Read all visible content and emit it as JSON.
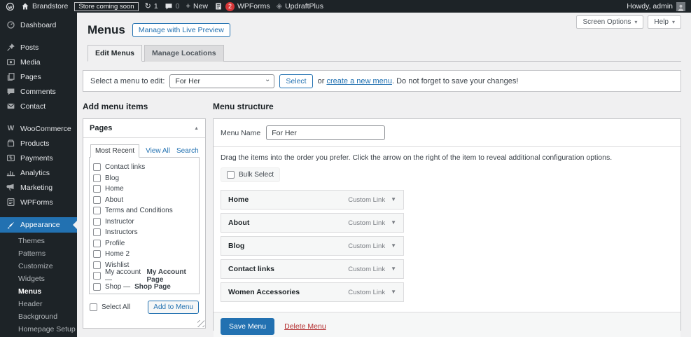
{
  "icons": {
    "woocommerce": "W",
    "payments_dollar": "$",
    "plus": "+",
    "update": "↻",
    "updraft": "◈",
    "collapse_up": "▲",
    "dropdown_down": "▼",
    "small_down": "▾",
    "select_chevron": "⌄"
  },
  "admin_bar": {
    "site_name": "Brandstore",
    "coming_soon_badge": "Store coming soon",
    "update_count": "1",
    "comment_count": "0",
    "new_label": "New",
    "wpforms_badge": "2",
    "wpforms_label": "WPForms",
    "updraft_label": "UpdraftPlus",
    "howdy": "Howdy, admin"
  },
  "sidebar": {
    "items": [
      {
        "label": "Dashboard"
      },
      {
        "label": "Posts"
      },
      {
        "label": "Media"
      },
      {
        "label": "Pages"
      },
      {
        "label": "Comments"
      },
      {
        "label": "Contact"
      },
      {
        "label": "WooCommerce"
      },
      {
        "label": "Products"
      },
      {
        "label": "Payments"
      },
      {
        "label": "Analytics"
      },
      {
        "label": "Marketing"
      },
      {
        "label": "WPForms"
      }
    ],
    "appearance_label": "Appearance",
    "submenu": [
      {
        "label": "Themes"
      },
      {
        "label": "Patterns"
      },
      {
        "label": "Customize"
      },
      {
        "label": "Widgets"
      },
      {
        "label": "Menus"
      },
      {
        "label": "Header"
      },
      {
        "label": "Background"
      },
      {
        "label": "Homepage Setup"
      }
    ]
  },
  "header": {
    "title": "Menus",
    "live_preview_button": "Manage with Live Preview",
    "screen_options": "Screen Options",
    "help": "Help"
  },
  "tabs": {
    "edit_menus": "Edit Menus",
    "manage_locations": "Manage Locations"
  },
  "select_bar": {
    "label": "Select a menu to edit:",
    "selected_menu": "For Her",
    "select_button": "Select",
    "or_text": "or",
    "create_link": "create a new menu",
    "after_text": ". Do not forget to save your changes!"
  },
  "add_menu_items": {
    "heading": "Add menu items",
    "box_title": "Pages",
    "tab_most_recent": "Most Recent",
    "tab_view_all": "View All",
    "tab_search": "Search",
    "pages": [
      {
        "label": "Contact links"
      },
      {
        "label": "Blog"
      },
      {
        "label": "Home"
      },
      {
        "label": "About"
      },
      {
        "label": "Terms and Conditions"
      },
      {
        "label": "Instructor"
      },
      {
        "label": "Instructors"
      },
      {
        "label": "Profile"
      },
      {
        "label": "Home 2"
      },
      {
        "label": "Wishlist"
      },
      {
        "label": "My account — ",
        "bold": "My Account Page"
      },
      {
        "label": "Shop — ",
        "bold": "Shop Page"
      }
    ],
    "select_all": "Select All",
    "add_button": "Add to Menu"
  },
  "menu_structure": {
    "heading": "Menu structure",
    "name_label": "Menu Name",
    "name_value": "For Her",
    "instructions": "Drag the items into the order you prefer. Click the arrow on the right of the item to reveal additional configuration options.",
    "bulk_select": "Bulk Select",
    "items": [
      {
        "title": "Home",
        "type": "Custom Link"
      },
      {
        "title": "About",
        "type": "Custom Link"
      },
      {
        "title": "Blog",
        "type": "Custom Link"
      },
      {
        "title": "Contact links",
        "type": "Custom Link"
      },
      {
        "title": "Women Accessories",
        "type": "Custom Link"
      }
    ],
    "save_button": "Save Menu",
    "delete_link": "Delete Menu"
  }
}
